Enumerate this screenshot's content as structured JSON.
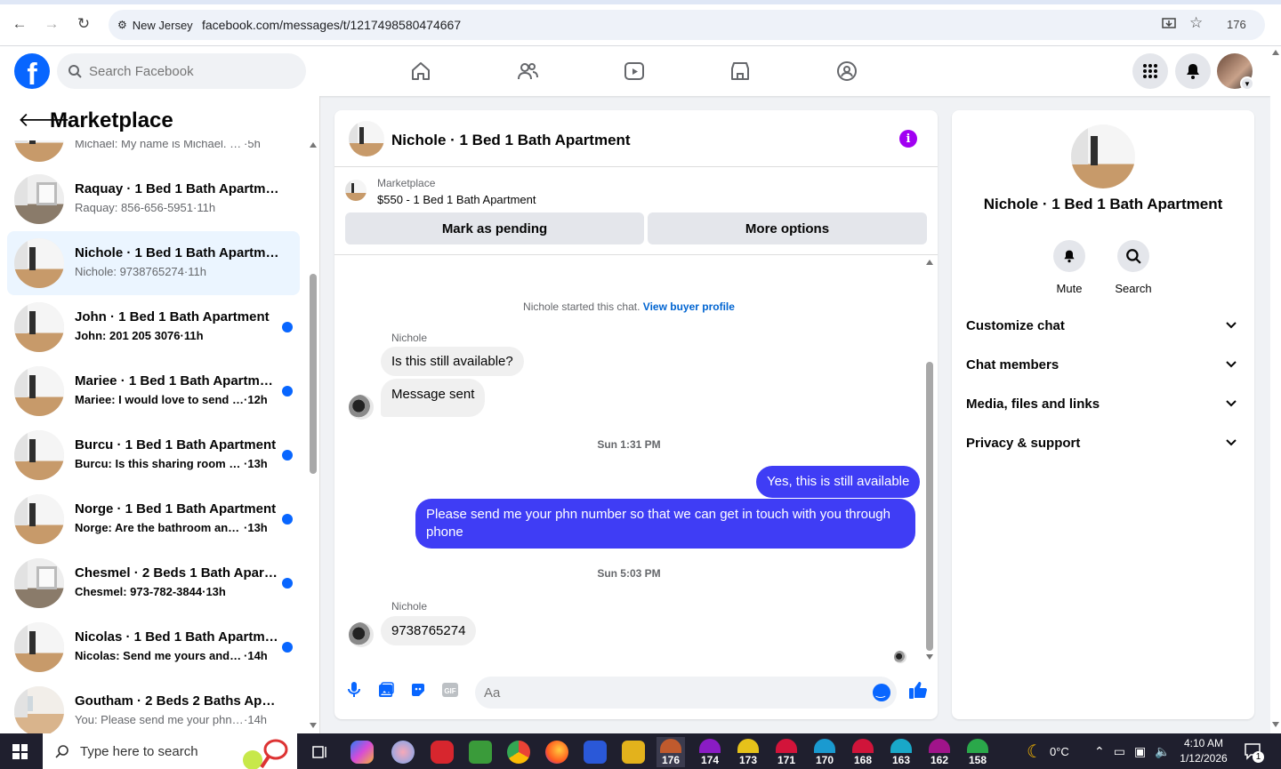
{
  "browser": {
    "location_chip": "New Jersey",
    "url": "facebook.com/messages/t/1217498580474667",
    "counter": "176"
  },
  "fb": {
    "logo": "f",
    "search_placeholder": "Search Facebook",
    "brand_color": "#0866ff"
  },
  "left": {
    "title": "Marketplace",
    "conversations": [
      {
        "title": "",
        "snippet": "Michael: My name is Michael. My p...",
        "time": "5h",
        "unread": false,
        "active": false
      },
      {
        "title": "Raquay · 1 Bed 1 Bath Apartment",
        "snippet": "Raquay: 856-656-5951",
        "time": "11h",
        "unread": false,
        "active": false
      },
      {
        "title": "Nichole · 1 Bed 1 Bath Apartment",
        "snippet": "Nichole: 9738765274",
        "time": "11h",
        "unread": false,
        "active": true
      },
      {
        "title": "John · 1 Bed 1 Bath Apartment",
        "snippet": "John: 201 205 3076",
        "time": "11h",
        "unread": true,
        "active": false
      },
      {
        "title": "Mariee · 1 Bed 1 Bath Apartment",
        "snippet": "Mariee: I would love to send y...",
        "time": "12h",
        "unread": true,
        "active": false
      },
      {
        "title": "Burcu · 1 Bed 1 Bath Apartment",
        "snippet": "Burcu: Is this sharing room or ...",
        "time": "13h",
        "unread": true,
        "active": false
      },
      {
        "title": "Norge · 1 Bed 1 Bath Apartment",
        "snippet": "Norge: Are the bathroom and ...",
        "time": "13h",
        "unread": true,
        "active": false
      },
      {
        "title": "Chesmel · 2 Beds 1 Bath Apart...",
        "snippet": "Chesmel: 973-782-3844",
        "time": "13h",
        "unread": true,
        "active": false
      },
      {
        "title": "Nicolas · 1 Bed 1 Bath Apartment",
        "snippet": "Nicolas: Send me yours and th...",
        "time": "14h",
        "unread": true,
        "active": false
      },
      {
        "title": "Goutham · 2 Beds 2 Baths Apart...",
        "snippet": "You: Please send me your phn nu...",
        "time": "14h",
        "unread": false,
        "active": false
      }
    ]
  },
  "chat": {
    "title": "Nichole · 1 Bed 1 Bath Apartment",
    "info_glyph": "i",
    "listing_source": "Marketplace",
    "listing_price": "$550 - 1 Bed 1 Bath Apartment",
    "mark_pending": "Mark as pending",
    "more_options": "More options",
    "started_text": "Nichole started this chat.",
    "buyer_profile_link": "View buyer profile",
    "sender_name": "Nichole",
    "msg_1": "Is this still available?",
    "msg_2": "Message sent",
    "time_1": "Sun 1:31 PM",
    "out_1": "Yes, this is still available",
    "out_2": "Please send me your phn number so that we can get in touch with you through phone",
    "time_2": "Sun 5:03 PM",
    "sender_name_2": "Nichole",
    "msg_3": "9738765274",
    "composer_placeholder": "Aa",
    "outgoing_color": "#3f3df5"
  },
  "right": {
    "name": "Nichole · 1 Bed 1 Bath Apartment",
    "mute": "Mute",
    "search": "Search",
    "sections": [
      "Customize chat",
      "Chat members",
      "Media, files and links",
      "Privacy & support"
    ]
  },
  "taskbar": {
    "search_placeholder": "Type here to search",
    "badges": [
      "176",
      "174",
      "173",
      "171",
      "170",
      "168",
      "163",
      "162",
      "158"
    ],
    "weather": "0°C",
    "time": "4:10 AM",
    "date": "1/12/2026",
    "notification_count": "1"
  }
}
